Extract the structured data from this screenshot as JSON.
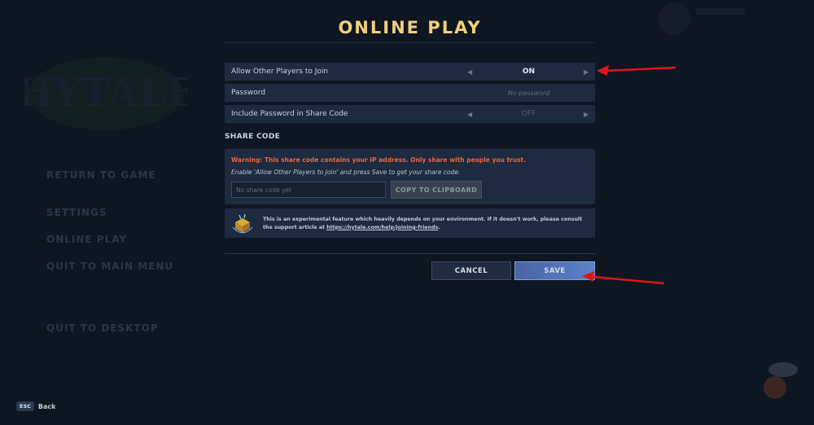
{
  "title": "ONLINE PLAY",
  "background_menu": {
    "items": [
      "RETURN TO GAME",
      "SETTINGS",
      "ONLINE PLAY",
      "QUIT TO MAIN MENU",
      "QUIT TO DESKTOP"
    ]
  },
  "settings": {
    "allow_join": {
      "label": "Allow Other Players to Join",
      "value": "ON"
    },
    "password": {
      "label": "Password",
      "placeholder": "No password"
    },
    "include_password": {
      "label": "Include Password in Share Code",
      "value": "OFF"
    }
  },
  "share_code": {
    "heading": "SHARE CODE",
    "warning": "Warning: This share code contains your IP address. Only share with people you trust.",
    "hint": "Enable 'Allow Other Players to Join' and press Save to get your share code.",
    "input_placeholder": "No share code yet",
    "copy_label": "COPY TO CLIPBOARD"
  },
  "info": {
    "text_before": "This is an experimental feature which heavily depends on your environment. If it doesn't work, please consult the support article at ",
    "link": "https://hytale.com/help/joining-friends",
    "text_after": "."
  },
  "buttons": {
    "cancel": "CANCEL",
    "save": "SAVE"
  },
  "footer": {
    "key": "ESC",
    "label": "Back"
  },
  "colors": {
    "title": "#f2cf7a",
    "warning": "#e9663e",
    "save": "#5a82c8",
    "annotation_arrow": "#e0161b"
  }
}
